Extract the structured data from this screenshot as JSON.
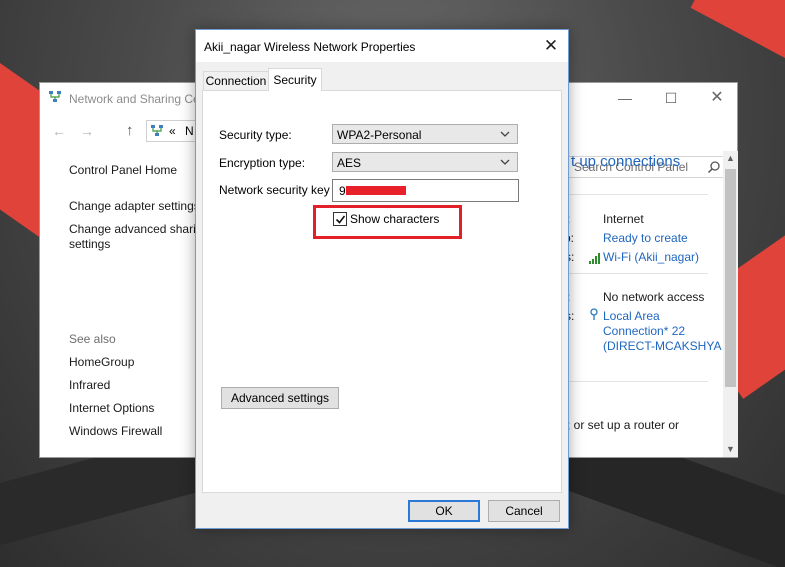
{
  "control_panel": {
    "title": "Network and Sharing Ce",
    "address_chevron": "«",
    "address_text": "N",
    "search_placeholder": "Search Control Panel",
    "left_links": [
      "Control Panel Home",
      "Change adapter settings",
      "Change advanced sharing",
      "settings"
    ],
    "see_also_label": "See also",
    "see_also_links": [
      "HomeGroup",
      "Infrared",
      "Internet Options",
      "Windows Firewall"
    ],
    "heading_fragment": "t up connections",
    "access_type_frag": ":",
    "access_type_value": "Internet",
    "homegroup_frag": "p:",
    "homegroup_link": "Ready to create",
    "connections_frag": "s:",
    "connections_link": "Wi-Fi (Akii_nagar)",
    "access_type2_frag": ":",
    "access_type2_value": "No network access",
    "connections2_frag": "s:",
    "connections2_link_lines": [
      "Local Area",
      "Connection* 22",
      "(DIRECT-MCAKSHYA"
    ],
    "router_text": "; or set up a router or"
  },
  "dialog": {
    "title": "Akii_nagar Wireless Network Properties",
    "tabs": [
      "Connection",
      "Security"
    ],
    "active_tab": "Security",
    "security_type_label": "Security type:",
    "security_type_value": "WPA2-Personal",
    "encryption_type_label": "Encryption type:",
    "encryption_type_value": "AES",
    "network_key_label": "Network security key",
    "network_key_visible": "9",
    "show_characters_label": "Show characters",
    "show_characters_checked": true,
    "advanced_button": "Advanced settings",
    "ok_button": "OK",
    "cancel_button": "Cancel"
  },
  "colors": {
    "link_blue": "#1f66bf",
    "highlight_red": "#e3202a",
    "redaction_red": "#e8202a",
    "focus_blue": "#2a78d8"
  }
}
